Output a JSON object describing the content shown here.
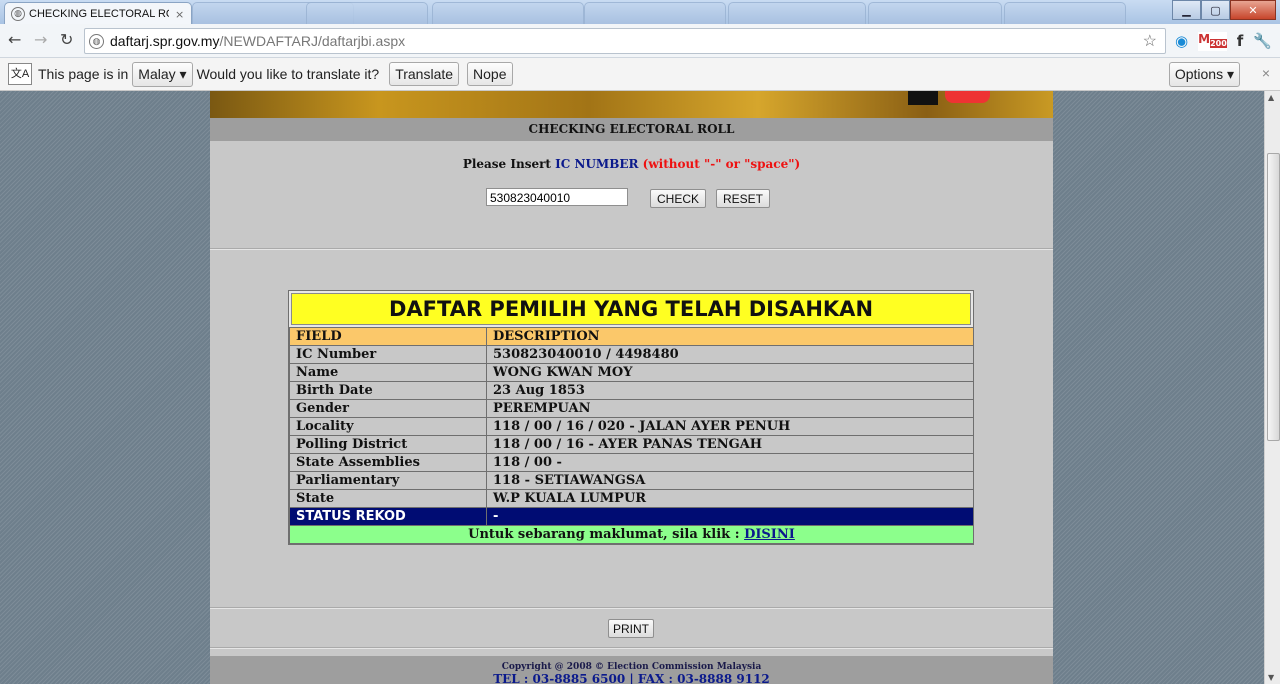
{
  "browser": {
    "tab_title": "CHECKING ELECTORAL ROL",
    "tab_close": "×",
    "url_host": "daftarj.spr.gov.my",
    "url_path": "/NEWDAFTARJ/daftarjbi.aspx",
    "gmail_count": "200"
  },
  "infobar": {
    "prefix": "This page is in",
    "language": "Malay",
    "question": "Would you like to translate it?",
    "translate": "Translate",
    "nope": "Nope",
    "options": "Options",
    "close": "×"
  },
  "page": {
    "title": "CHECKING ELECTORAL ROLL",
    "instruction_prefix": "Please Insert",
    "instruction_ic": "IC NUMBER",
    "instruction_note": "(without \"-\" or \"space\")",
    "ic_value": "530823040010",
    "check_label": "CHECK",
    "reset_label": "RESET",
    "print_label": "PRINT"
  },
  "result": {
    "heading": "DAFTAR PEMILIH YANG TELAH DISAHKAN",
    "header": {
      "field": "FIELD",
      "description": "DESCRIPTION"
    },
    "rows": [
      {
        "field": "IC Number",
        "value": "530823040010 / 4498480"
      },
      {
        "field": "Name",
        "value": "WONG KWAN MOY"
      },
      {
        "field": "Birth Date",
        "value": "23 Aug 1853"
      },
      {
        "field": "Gender",
        "value": "PEREMPUAN"
      },
      {
        "field": "Locality",
        "value": "118 / 00 / 16 / 020 - JALAN AYER PENUH"
      },
      {
        "field": "Polling District",
        "value": "118 / 00 / 16 - AYER PANAS TENGAH"
      },
      {
        "field": "State Assemblies",
        "value": "118 / 00 -"
      },
      {
        "field": "Parliamentary",
        "value": "118 - SETIAWANGSA"
      },
      {
        "field": "State",
        "value": "W.P KUALA LUMPUR"
      }
    ],
    "status": {
      "field": "STATUS REKOD",
      "value": "-"
    },
    "info_text": "Untuk sebarang maklumat, sila klik :",
    "info_link": "DISINI"
  },
  "footer": {
    "copyright": "Copyright @ 2008 © Election Commission Malaysia",
    "tel": "TEL : 03-8885 6500 | FAX : 03-8888 9112"
  },
  "colors": {
    "result_heading_bg": "#ffff22",
    "header_row_bg": "#fbc86a",
    "status_row_bg": "#000c73",
    "info_row_bg": "#8cff8c"
  }
}
